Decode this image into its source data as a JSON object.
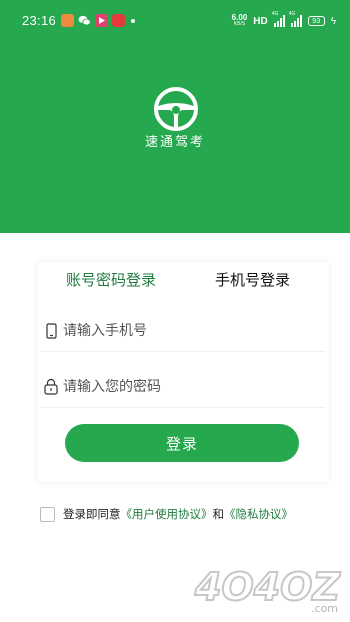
{
  "status_bar": {
    "time": "23:16",
    "net_speed_value": "6.00",
    "net_speed_unit": "KB/S",
    "hd_label": "HD",
    "signal_label_1": "4G",
    "signal_label_2": "4G",
    "battery": "93"
  },
  "app": {
    "name": "速通驾考",
    "logo_icon": "steering-wheel-icon",
    "brand_color": "#26a84f",
    "accent_text_color": "#1f7a3f"
  },
  "tabs": [
    {
      "label": "账号密码登录",
      "active": true
    },
    {
      "label": "手机号登录",
      "active": false
    }
  ],
  "form": {
    "phone_placeholder": "请输入手机号",
    "password_placeholder": "请输入您的密码",
    "submit_label": "登录"
  },
  "agreement": {
    "prefix": "登录即同意",
    "user_agreement": "《用户使用协议》",
    "conjunction": "和",
    "privacy_agreement": "《隐私协议》",
    "checked": false
  },
  "watermark": {
    "text": "4O4OZ",
    "suffix": ".com"
  }
}
